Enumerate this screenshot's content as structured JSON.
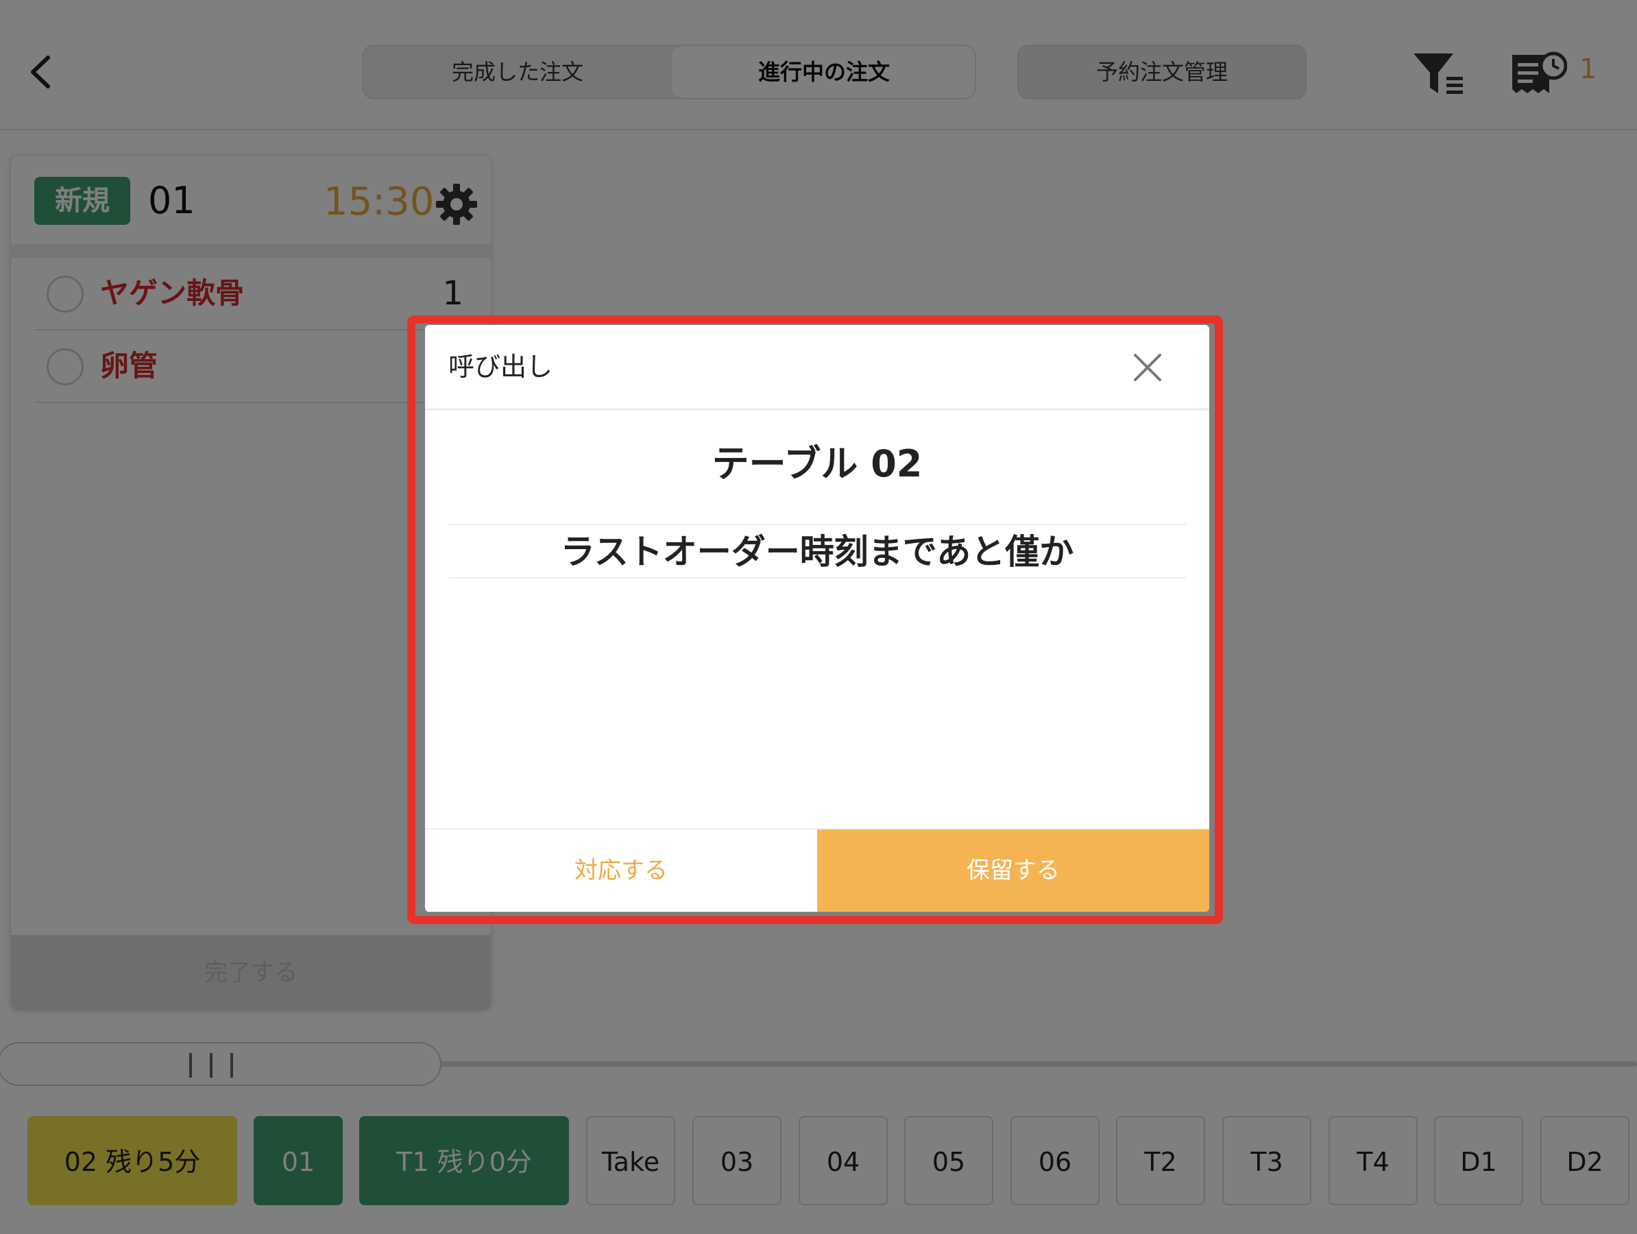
{
  "header": {
    "tabs": [
      {
        "label": "完成した注文"
      },
      {
        "label": "進行中の注文"
      }
    ],
    "reservation_label": "予約注文管理",
    "notification_count": "1"
  },
  "order_card": {
    "status": "新規",
    "table": "01",
    "time": "15:30",
    "items": [
      {
        "name": "ヤゲン軟骨",
        "qty": "1"
      },
      {
        "name": "卵管",
        "qty": ""
      }
    ],
    "complete_label": "完了する"
  },
  "tables": [
    {
      "label": "02 残り5分",
      "state": "yellow"
    },
    {
      "label": "01",
      "state": "green"
    },
    {
      "label": "T1 残り0分",
      "state": "green"
    },
    {
      "label": "Take",
      "state": "default"
    },
    {
      "label": "03",
      "state": "default"
    },
    {
      "label": "04",
      "state": "default"
    },
    {
      "label": "05",
      "state": "default"
    },
    {
      "label": "06",
      "state": "default"
    },
    {
      "label": "T2",
      "state": "default"
    },
    {
      "label": "T3",
      "state": "default"
    },
    {
      "label": "T4",
      "state": "default"
    },
    {
      "label": "D1",
      "state": "default"
    },
    {
      "label": "D2",
      "state": "default"
    }
  ],
  "modal": {
    "title": "呼び出し",
    "table": "テーブル 02",
    "message": "ラストオーダー時刻まであと僅か",
    "respond_label": "対応する",
    "hold_label": "保留する"
  },
  "colors": {
    "accent": "#f5b452",
    "green": "#3f9e6f",
    "yellow": "#f1e04c",
    "highlight": "#e5332a",
    "item_red": "#d12b2b"
  }
}
